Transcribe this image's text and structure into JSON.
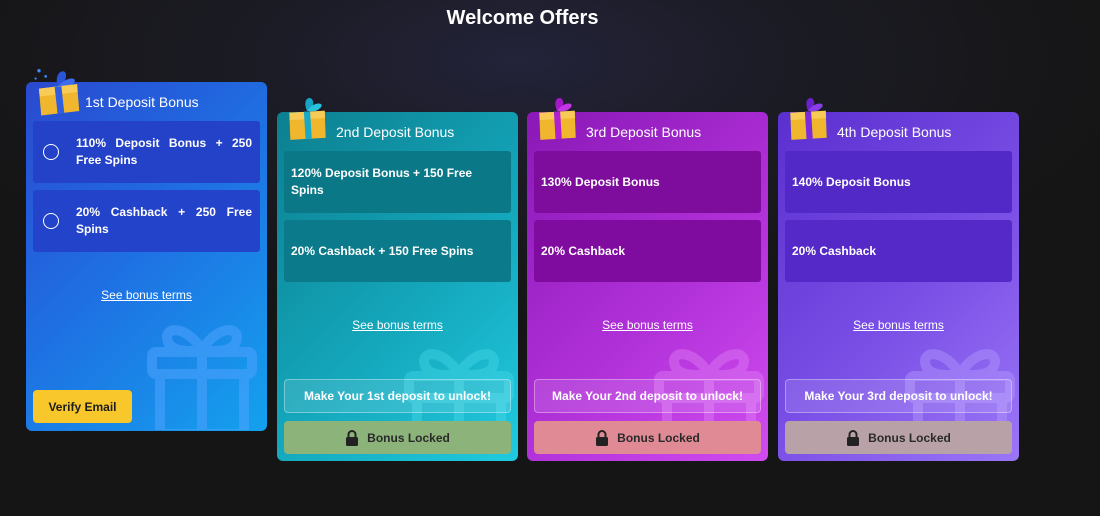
{
  "page": {
    "title": "Welcome Offers"
  },
  "cards": [
    {
      "title": "1st Deposit Bonus",
      "options": [
        {
          "text": "110% Deposit Bonus + 250 Free Spins"
        },
        {
          "text": "20% Cashback + 250 Free Spins"
        }
      ],
      "terms_label": "See bonus terms",
      "action_label": "Verify Email"
    },
    {
      "title": "2nd Deposit Bonus",
      "options": [
        {
          "text": "120% Deposit Bonus + 150 Free Spins"
        },
        {
          "text": "20% Cashback + 150 Free Spins"
        }
      ],
      "terms_label": "See bonus terms",
      "unlock_label": "Make Your 1st deposit to unlock!",
      "locked_label": "Bonus Locked"
    },
    {
      "title": "3rd Deposit Bonus",
      "options": [
        {
          "text": "130% Deposit Bonus"
        },
        {
          "text": "20% Cashback"
        }
      ],
      "terms_label": "See bonus terms",
      "unlock_label": "Make Your 2nd deposit to unlock!",
      "locked_label": "Bonus Locked"
    },
    {
      "title": "4th Deposit Bonus",
      "options": [
        {
          "text": "140% Deposit Bonus"
        },
        {
          "text": "20% Cashback"
        }
      ],
      "terms_label": "See bonus terms",
      "unlock_label": "Make Your 3rd deposit to unlock!",
      "locked_label": "Bonus Locked"
    }
  ],
  "colors": {
    "card1_bg": [
      "#2a49cf",
      "#14a1ee"
    ],
    "card2_bg": [
      "#0c7f8f",
      "#1fc7dd"
    ],
    "card3_bg": [
      "#8a18b6",
      "#d04cf0"
    ],
    "card4_bg": [
      "#5a2fcf",
      "#9b76f7"
    ],
    "verify_button": "#f7c72b",
    "locked_card2": "#8cb37a",
    "locked_card3": "#e08a96",
    "locked_card4": "#b9a2a7"
  },
  "icons": {
    "header": "gift-icon",
    "radio": "radio-unchecked-icon",
    "locked": "lock-icon",
    "watermark": "gift-outline-icon"
  }
}
